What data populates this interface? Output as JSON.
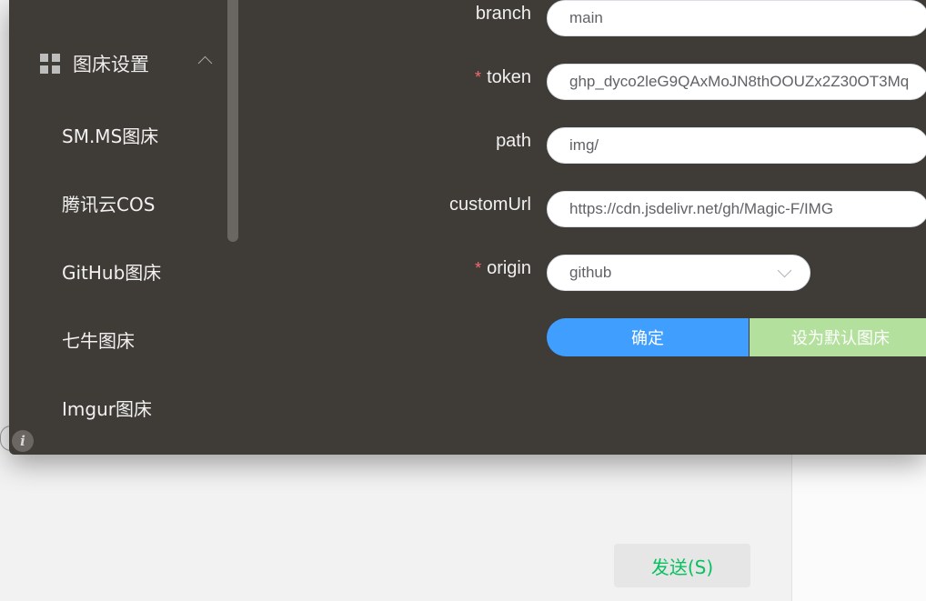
{
  "chat": {
    "send_label": "发送(S)"
  },
  "sidebar": {
    "group_label": "图床设置",
    "items": [
      {
        "label": "SM.MS图床"
      },
      {
        "label": "腾讯云COS"
      },
      {
        "label": "GitHub图床"
      },
      {
        "label": "七牛图床"
      },
      {
        "label": "Imgur图床"
      }
    ]
  },
  "form": {
    "branch": {
      "label": "branch",
      "value": "main"
    },
    "token": {
      "label": "token",
      "required": "*",
      "value": "ghp_dyco2leG9QAxMoJN8thOOUZx2Z30OT3Mq"
    },
    "path": {
      "label": "path",
      "value": "img/"
    },
    "customUrl": {
      "label": "customUrl",
      "value": "https://cdn.jsdelivr.net/gh/Magic-F/IMG"
    },
    "origin": {
      "label": "origin",
      "required": "*",
      "value": "github"
    },
    "confirm_label": "确定",
    "default_label": "设为默认图床"
  },
  "colors": {
    "background": "#3f3b37",
    "primary": "#409eff",
    "success_light": "#b3e19d",
    "required": "#f56c6c",
    "send_text": "#07c160"
  }
}
